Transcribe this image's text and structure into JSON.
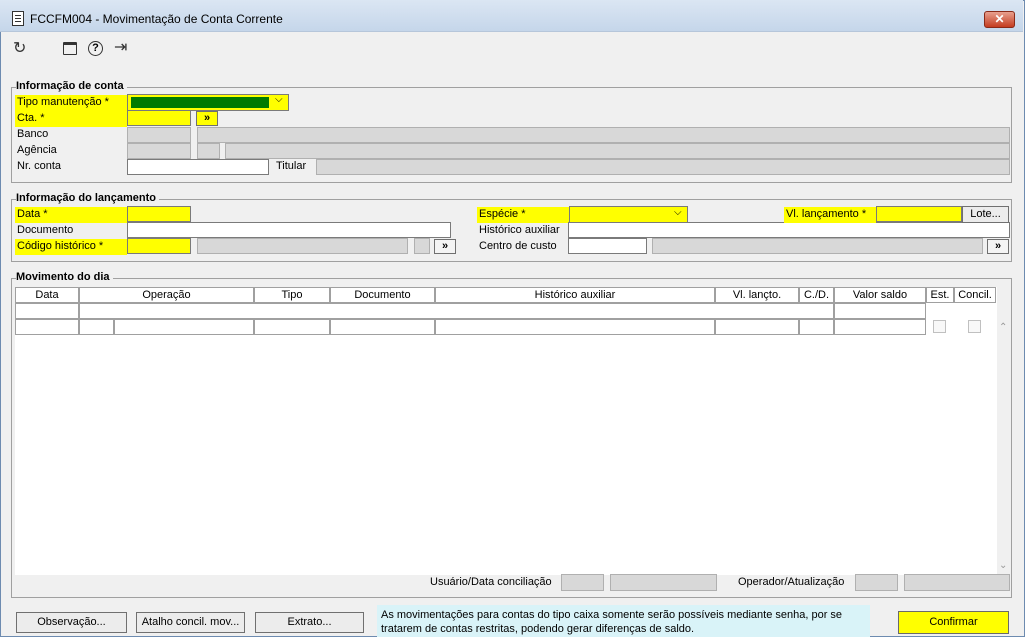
{
  "window": {
    "title": "FCCFM004 - Movimentação de Conta Corrente",
    "close_label": "✕"
  },
  "toolbar": {
    "refresh_icon": "↻",
    "calendar_icon": "▭",
    "help_icon": "?",
    "exit_icon": "⇥"
  },
  "conta": {
    "group_title": "Informação de conta",
    "tipo_manutencao_label": "Tipo manutenção *",
    "cta_label": "Cta. *",
    "banco_label": "Banco",
    "agencia_label": "Agência",
    "nr_conta_label": "Nr. conta",
    "titular_label": "Titular",
    "lookup_label": "»"
  },
  "lancamento": {
    "group_title": "Informação do lançamento",
    "data_label": "Data *",
    "documento_label": "Documento",
    "codigo_historico_label": "Código histórico *",
    "especie_label": "Espécie *",
    "historico_auxiliar_label": "Histórico auxiliar",
    "centro_custo_label": "Centro de custo",
    "vl_lancamento_label": "Vl. lançamento *",
    "lote_label": "Lote...",
    "lookup_label": "»"
  },
  "movimento": {
    "group_title": "Movimento do dia",
    "columns": [
      "Data",
      "Operação",
      "Tipo",
      "Documento",
      "Histórico auxiliar",
      "Vl. lançto.",
      "C./D.",
      "Valor saldo",
      "Est.",
      "Concil."
    ],
    "usuario_label": "Usuário/Data conciliação",
    "operador_label": "Operador/Atualização"
  },
  "footer": {
    "observacao_label": "Observação...",
    "atalho_label": "Atalho concil. mov...",
    "extrato_label": "Extrato...",
    "info_text_1": "As movimentações para contas do tipo caixa somente serão possíveis mediante senha, por se",
    "info_text_2": "tratarem de contas restritas, podendo gerar diferenças de saldo.",
    "confirmar_label": "Confirmar"
  }
}
